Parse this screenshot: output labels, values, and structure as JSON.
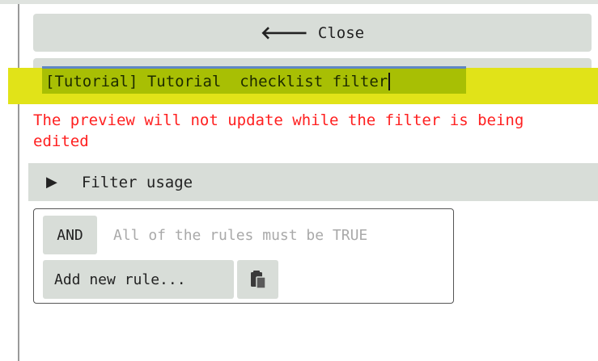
{
  "close_button": {
    "label": "Close",
    "icon": "arrow-left-icon"
  },
  "filter_name": {
    "value": "[Tutorial] Tutorial  checklist filter"
  },
  "warning": {
    "text": "The preview will not update while the filter is being edited"
  },
  "filter_usage": {
    "label": "Filter usage",
    "icon": "triangle-right-icon"
  },
  "rules": {
    "operator_label": "AND",
    "operator_description": "All of the rules must be TRUE",
    "add_rule_label": "Add new rule...",
    "paste_icon": "paste-icon"
  },
  "colors": {
    "highlight": "#e1e318",
    "input_selected": "#a8bf04",
    "warning": "#ff2020",
    "button_bg": "#d8ddd8"
  }
}
